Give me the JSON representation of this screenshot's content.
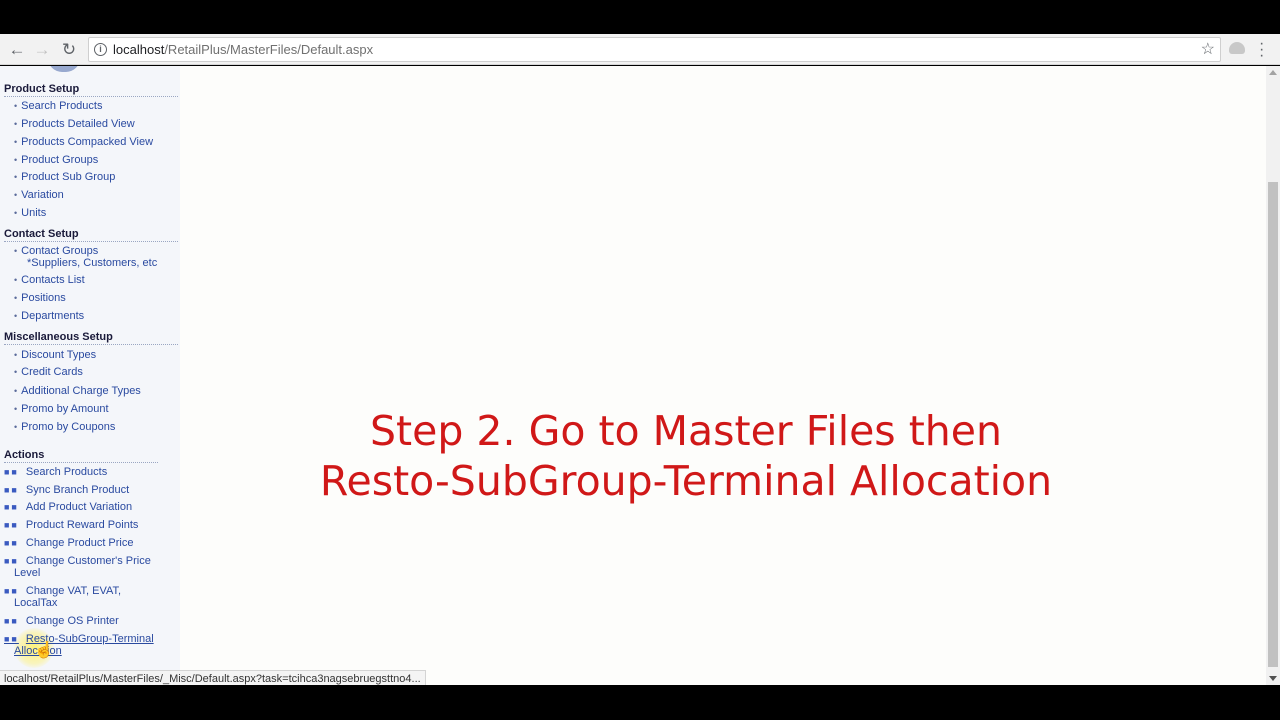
{
  "browser": {
    "url_host": "localhost",
    "url_path": "/RetailPlus/MasterFiles/Default.aspx"
  },
  "sidebar": {
    "product_setup": {
      "title": "Product Setup",
      "items": [
        "Search Products",
        "Products Detailed View",
        "Products Compacked View",
        "Product Groups",
        "Product Sub Group",
        "Variation",
        "Units"
      ]
    },
    "contact_setup": {
      "title": "Contact Setup",
      "items": [
        "Contact Groups",
        "Contacts List",
        "Positions",
        "Departments"
      ],
      "contact_groups_note": "*Suppliers, Customers, etc"
    },
    "misc_setup": {
      "title": "Miscellaneous Setup",
      "items": [
        "Discount Types",
        "Credit Cards",
        "Additional Charge Types",
        "Promo by Amount",
        "Promo by Coupons"
      ]
    },
    "actions": {
      "title": "Actions",
      "items": [
        {
          "l1": "Search Products",
          "l2": ""
        },
        {
          "l1": "Sync Branch Product",
          "l2": ""
        },
        {
          "l1": "Add Product Variation",
          "l2": ""
        },
        {
          "l1": "Product Reward Points",
          "l2": ""
        },
        {
          "l1": "Change Product Price",
          "l2": ""
        },
        {
          "l1": "Change Customer's Price",
          "l2": "Level"
        },
        {
          "l1": "Change VAT, EVAT,",
          "l2": "LocalTax"
        },
        {
          "l1": "Change OS Printer",
          "l2": ""
        },
        {
          "l1": "Resto-SubGroup-Terminal",
          "l2": "Allocation"
        }
      ]
    }
  },
  "overlay": {
    "line1": "Step 2. Go to Master Files then",
    "line2": "Resto-SubGroup-Terminal Allocation"
  },
  "status_url": "localhost/RetailPlus/MasterFiles/_Misc/Default.aspx?task=tcihca3nagsebruegsttno4...",
  "colors": {
    "overlay_text": "#d01818",
    "link": "#2a4aa0"
  }
}
